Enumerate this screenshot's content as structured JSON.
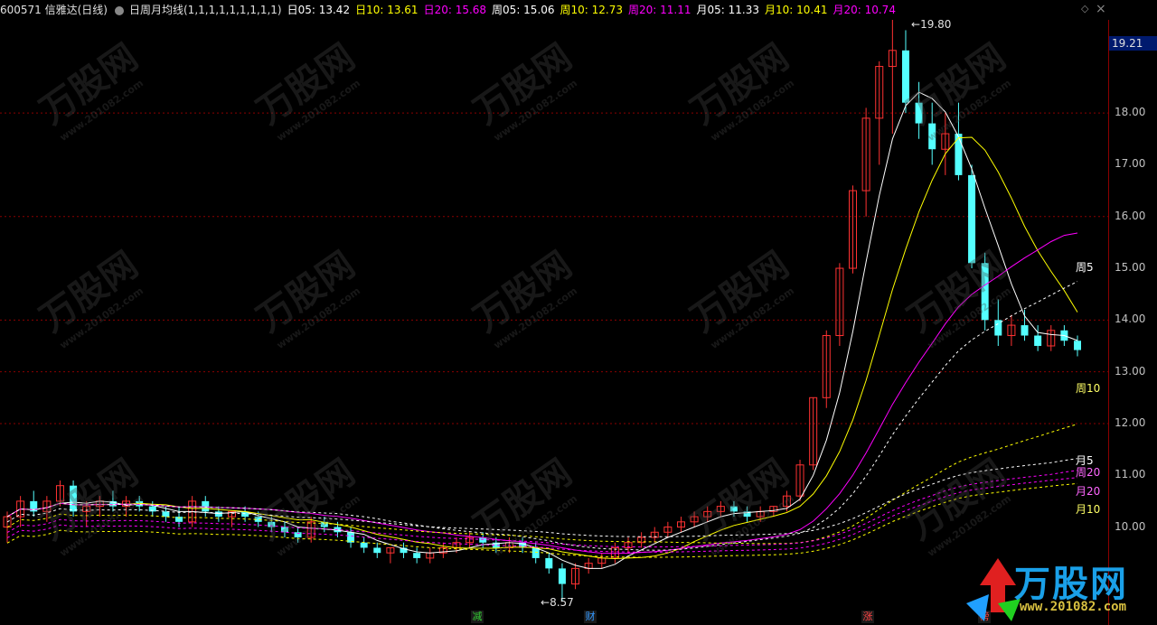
{
  "header": {
    "stock": "600571 信雅达(日线)",
    "indicator": "日周月均线(1,1,1,1,1,1,1,1,1)",
    "items": [
      {
        "label": "日05: 13.42",
        "color": "#ffffff"
      },
      {
        "label": "日10: 13.61",
        "color": "#ffff00"
      },
      {
        "label": "日20: 15.68",
        "color": "#ff00ff"
      },
      {
        "label": "周05: 15.06",
        "color": "#ffffff"
      },
      {
        "label": "周10: 12.73",
        "color": "#ffff00"
      },
      {
        "label": "周20: 11.11",
        "color": "#ff00ff"
      },
      {
        "label": "月05: 11.33",
        "color": "#ffffff"
      },
      {
        "label": "月10: 10.41",
        "color": "#ffff00"
      },
      {
        "label": "月20: 10.74",
        "color": "#ff00ff"
      }
    ]
  },
  "axis": {
    "ticks": [
      "18.00",
      "17.00",
      "16.00",
      "15.00",
      "14.00",
      "13.00",
      "12.00",
      "11.00",
      "10.00"
    ],
    "current_price": "19.21",
    "high_label": "19.80",
    "low_label": "8.57"
  },
  "ma_labels": [
    {
      "text": "周5",
      "color": "#ffffff"
    },
    {
      "text": "周10",
      "color": "#ffff66"
    },
    {
      "text": "月5",
      "color": "#ffffff"
    },
    {
      "text": "周20",
      "color": "#ff66ff"
    },
    {
      "text": "月20",
      "color": "#ff66ff"
    },
    {
      "text": "月10",
      "color": "#ffff66"
    }
  ],
  "events": [
    {
      "label": "减",
      "color": "#33cc33"
    },
    {
      "label": "财",
      "color": "#3399ff"
    },
    {
      "label": "涨",
      "color": "#ff4444"
    },
    {
      "label": "榜",
      "color": "#ff4444"
    }
  ],
  "watermark": {
    "text": "万股网",
    "url": "www.201082.com"
  },
  "logo": {
    "text": "万股网",
    "url": "www.201082.com"
  },
  "chart_data": {
    "type": "candlestick",
    "symbol": "600571",
    "ylim": [
      8.5,
      20.0
    ],
    "high": 19.8,
    "low": 8.57,
    "last": 19.21,
    "candles": [
      [
        10.0,
        10.3,
        9.7,
        10.2
      ],
      [
        10.2,
        10.6,
        10.0,
        10.5
      ],
      [
        10.5,
        10.7,
        10.2,
        10.3
      ],
      [
        10.3,
        10.6,
        10.1,
        10.5
      ],
      [
        10.5,
        10.9,
        10.4,
        10.8
      ],
      [
        10.8,
        10.9,
        10.2,
        10.3
      ],
      [
        10.3,
        10.5,
        10.0,
        10.4
      ],
      [
        10.4,
        10.6,
        10.2,
        10.5
      ],
      [
        10.5,
        10.7,
        10.3,
        10.4
      ],
      [
        10.4,
        10.6,
        10.2,
        10.5
      ],
      [
        10.5,
        10.6,
        10.3,
        10.4
      ],
      [
        10.4,
        10.5,
        10.2,
        10.3
      ],
      [
        10.3,
        10.4,
        10.1,
        10.2
      ],
      [
        10.2,
        10.4,
        10.0,
        10.1
      ],
      [
        10.1,
        10.6,
        10.0,
        10.5
      ],
      [
        10.5,
        10.6,
        10.2,
        10.3
      ],
      [
        10.3,
        10.4,
        10.1,
        10.2
      ],
      [
        10.2,
        10.3,
        10.0,
        10.3
      ],
      [
        10.3,
        10.4,
        10.1,
        10.2
      ],
      [
        10.2,
        10.3,
        10.0,
        10.1
      ],
      [
        10.1,
        10.2,
        9.9,
        10.0
      ],
      [
        10.0,
        10.1,
        9.8,
        9.9
      ],
      [
        9.9,
        10.0,
        9.7,
        9.8
      ],
      [
        9.8,
        10.2,
        9.7,
        10.1
      ],
      [
        10.1,
        10.2,
        9.9,
        10.0
      ],
      [
        10.0,
        10.1,
        9.8,
        9.9
      ],
      [
        9.9,
        10.0,
        9.6,
        9.7
      ],
      [
        9.7,
        9.8,
        9.5,
        9.6
      ],
      [
        9.6,
        9.7,
        9.4,
        9.5
      ],
      [
        9.5,
        9.6,
        9.3,
        9.6
      ],
      [
        9.6,
        9.7,
        9.4,
        9.5
      ],
      [
        9.5,
        9.6,
        9.3,
        9.4
      ],
      [
        9.4,
        9.6,
        9.3,
        9.5
      ],
      [
        9.5,
        9.7,
        9.4,
        9.6
      ],
      [
        9.6,
        9.8,
        9.5,
        9.7
      ],
      [
        9.7,
        9.9,
        9.6,
        9.8
      ],
      [
        9.8,
        9.9,
        9.6,
        9.7
      ],
      [
        9.7,
        9.8,
        9.5,
        9.6
      ],
      [
        9.6,
        9.8,
        9.5,
        9.7
      ],
      [
        9.7,
        9.8,
        9.5,
        9.6
      ],
      [
        9.6,
        9.7,
        9.3,
        9.4
      ],
      [
        9.4,
        9.5,
        9.1,
        9.2
      ],
      [
        9.2,
        9.3,
        8.57,
        8.9
      ],
      [
        8.9,
        9.3,
        8.8,
        9.2
      ],
      [
        9.2,
        9.4,
        9.1,
        9.3
      ],
      [
        9.3,
        9.5,
        9.2,
        9.4
      ],
      [
        9.4,
        9.7,
        9.3,
        9.6
      ],
      [
        9.6,
        9.8,
        9.5,
        9.7
      ],
      [
        9.7,
        9.9,
        9.6,
        9.8
      ],
      [
        9.8,
        10.0,
        9.7,
        9.9
      ],
      [
        9.9,
        10.1,
        9.8,
        10.0
      ],
      [
        10.0,
        10.2,
        9.9,
        10.1
      ],
      [
        10.1,
        10.3,
        10.0,
        10.2
      ],
      [
        10.2,
        10.4,
        10.1,
        10.3
      ],
      [
        10.3,
        10.5,
        10.2,
        10.4
      ],
      [
        10.4,
        10.5,
        10.2,
        10.3
      ],
      [
        10.3,
        10.4,
        10.1,
        10.2
      ],
      [
        10.2,
        10.4,
        10.1,
        10.3
      ],
      [
        10.3,
        10.4,
        10.2,
        10.4
      ],
      [
        10.4,
        10.7,
        10.3,
        10.6
      ],
      [
        10.6,
        11.3,
        10.5,
        11.2
      ],
      [
        11.2,
        12.5,
        11.1,
        12.5
      ],
      [
        12.5,
        13.8,
        12.3,
        13.7
      ],
      [
        13.7,
        15.1,
        13.5,
        15.0
      ],
      [
        15.0,
        16.6,
        14.9,
        16.5
      ],
      [
        16.5,
        18.1,
        16.0,
        17.9
      ],
      [
        17.9,
        19.0,
        17.0,
        18.9
      ],
      [
        18.9,
        19.8,
        17.6,
        19.21
      ],
      [
        19.21,
        19.6,
        18.0,
        18.2
      ],
      [
        18.2,
        18.6,
        17.5,
        17.8
      ],
      [
        17.8,
        18.2,
        17.0,
        17.3
      ],
      [
        17.3,
        18.0,
        16.8,
        17.6
      ],
      [
        17.6,
        18.2,
        16.7,
        16.8
      ],
      [
        16.8,
        17.0,
        15.0,
        15.1
      ],
      [
        15.1,
        15.3,
        13.8,
        14.0
      ],
      [
        14.0,
        14.4,
        13.5,
        13.7
      ],
      [
        13.7,
        14.1,
        13.5,
        13.9
      ],
      [
        13.9,
        14.2,
        13.6,
        13.7
      ],
      [
        13.7,
        13.9,
        13.4,
        13.5
      ],
      [
        13.5,
        13.9,
        13.4,
        13.8
      ],
      [
        13.8,
        13.9,
        13.5,
        13.6
      ],
      [
        13.6,
        13.7,
        13.3,
        13.42
      ]
    ],
    "series": [
      {
        "name": "日05",
        "color": "#ffffff",
        "last": 13.42
      },
      {
        "name": "日10",
        "color": "#ffff00",
        "last": 13.61
      },
      {
        "name": "日20",
        "color": "#ff00ff",
        "last": 15.68
      },
      {
        "name": "周05",
        "color": "#ffffff",
        "last": 15.06
      },
      {
        "name": "周10",
        "color": "#ffff00",
        "last": 12.73
      },
      {
        "name": "周20",
        "color": "#ff00ff",
        "last": 11.11
      },
      {
        "name": "月05",
        "color": "#ffffff",
        "last": 11.33
      },
      {
        "name": "月10",
        "color": "#ffff00",
        "last": 10.41
      },
      {
        "name": "月20",
        "color": "#ff00ff",
        "last": 10.74
      }
    ]
  }
}
